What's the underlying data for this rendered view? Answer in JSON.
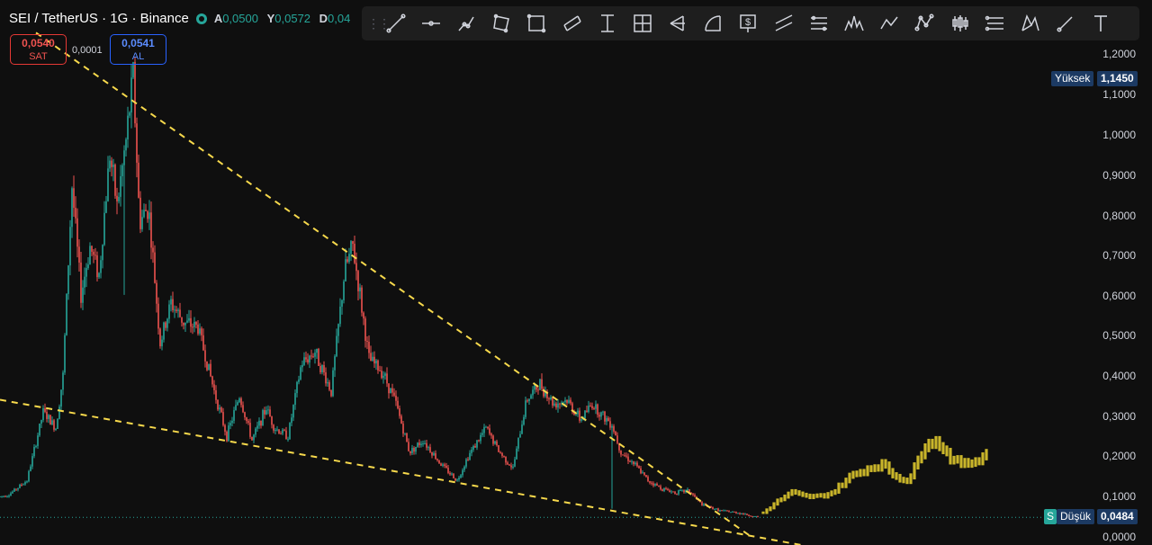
{
  "header": {
    "pair": "SEI / TetherUS · 1G · Binance",
    "open_label": "A",
    "open_value": "0,0500",
    "high_label": "Y",
    "high_value": "0,0572",
    "low_label": "D",
    "low_value": "0,04"
  },
  "trade": {
    "sell_price": "0,0540",
    "sell_label": "SAT",
    "spread": "0,0001",
    "buy_price": "0,0541",
    "buy_label": "AL"
  },
  "toolbar": {
    "icons": [
      "trend-line-icon",
      "horizontal-ray-icon",
      "polyline-icon",
      "rotated-rectangle-icon",
      "rectangle-icon",
      "parallel-channel-icon",
      "vertical-range-icon",
      "grid-icon",
      "pitchfork-icon",
      "arc-icon",
      "price-label-icon",
      "double-line-icon",
      "bars-pattern-icon",
      "head-shoulders-icon",
      "zigzag-icon",
      "nodes-icon",
      "candles-icon",
      "range-lines-icon",
      "xabcd-icon",
      "brush-icon",
      "text-icon"
    ]
  },
  "price_labels": {
    "high_label": "Yüksek",
    "high_value": "1,1450",
    "low_label": "Düşük",
    "low_value": "0,0484",
    "current_tag": "S"
  },
  "colors": {
    "up": "#26a69a",
    "down": "#ef5350",
    "projection": "#c9b52a",
    "trendline": "#f7d94c",
    "background": "#0f0f0f",
    "toolbar": "#1e1e1e"
  },
  "chart_data": {
    "type": "candlestick",
    "title": "SEI / TetherUS · 1G · Binance",
    "y_ticks": [
      "1,2000",
      "1,1000",
      "1,0000",
      "0,9000",
      "0,8000",
      "0,7000",
      "0,6000",
      "0,5000",
      "0,4000",
      "0,3000",
      "0,2000",
      "0,1000",
      "0,0000"
    ],
    "ylim": [
      0,
      1.25
    ],
    "x_index_range": [
      0,
      850
    ],
    "price_path": [
      [
        0,
        0.1
      ],
      [
        10,
        0.105
      ],
      [
        30,
        0.14
      ],
      [
        48,
        0.31
      ],
      [
        62,
        0.27
      ],
      [
        70,
        0.4
      ],
      [
        80,
        0.87
      ],
      [
        90,
        0.6
      ],
      [
        100,
        0.72
      ],
      [
        110,
        0.65
      ],
      [
        122,
        0.95
      ],
      [
        130,
        0.82
      ],
      [
        140,
        0.98
      ],
      [
        148,
        1.145
      ],
      [
        155,
        0.78
      ],
      [
        165,
        0.82
      ],
      [
        178,
        0.48
      ],
      [
        190,
        0.58
      ],
      [
        205,
        0.53
      ],
      [
        220,
        0.52
      ],
      [
        237,
        0.37
      ],
      [
        252,
        0.25
      ],
      [
        266,
        0.35
      ],
      [
        280,
        0.24
      ],
      [
        296,
        0.32
      ],
      [
        305,
        0.27
      ],
      [
        320,
        0.25
      ],
      [
        335,
        0.43
      ],
      [
        350,
        0.46
      ],
      [
        368,
        0.36
      ],
      [
        383,
        0.66
      ],
      [
        392,
        0.72
      ],
      [
        400,
        0.6
      ],
      [
        410,
        0.44
      ],
      [
        425,
        0.41
      ],
      [
        440,
        0.33
      ],
      [
        455,
        0.21
      ],
      [
        470,
        0.24
      ],
      [
        490,
        0.18
      ],
      [
        508,
        0.14
      ],
      [
        520,
        0.2
      ],
      [
        540,
        0.27
      ],
      [
        555,
        0.21
      ],
      [
        570,
        0.17
      ],
      [
        585,
        0.34
      ],
      [
        600,
        0.38
      ],
      [
        615,
        0.33
      ],
      [
        630,
        0.34
      ],
      [
        645,
        0.29
      ],
      [
        658,
        0.33
      ],
      [
        670,
        0.3
      ],
      [
        680,
        0.28
      ],
      [
        690,
        0.21
      ],
      [
        705,
        0.18
      ],
      [
        720,
        0.14
      ],
      [
        735,
        0.12
      ],
      [
        750,
        0.11
      ],
      [
        765,
        0.115
      ],
      [
        780,
        0.08
      ],
      [
        800,
        0.065
      ],
      [
        820,
        0.06
      ],
      [
        843,
        0.048
      ]
    ],
    "projection_path": [
      [
        848,
        0.06
      ],
      [
        865,
        0.09
      ],
      [
        880,
        0.11
      ],
      [
        895,
        0.1
      ],
      [
        910,
        0.1
      ],
      [
        925,
        0.11
      ],
      [
        945,
        0.15
      ],
      [
        965,
        0.17
      ],
      [
        980,
        0.18
      ],
      [
        995,
        0.15
      ],
      [
        1010,
        0.14
      ],
      [
        1020,
        0.19
      ],
      [
        1030,
        0.24
      ],
      [
        1045,
        0.23
      ],
      [
        1058,
        0.19
      ],
      [
        1072,
        0.18
      ],
      [
        1085,
        0.19
      ],
      [
        1098,
        0.21
      ]
    ],
    "trendlines": [
      {
        "from": [
          40,
          1.25
        ],
        "to": [
          835,
          0.0
        ]
      },
      {
        "from": [
          0,
          0.34
        ],
        "to": [
          890,
          -0.02
        ]
      }
    ],
    "current_price": 0.0484,
    "high": 1.145,
    "low": 0.0484
  }
}
